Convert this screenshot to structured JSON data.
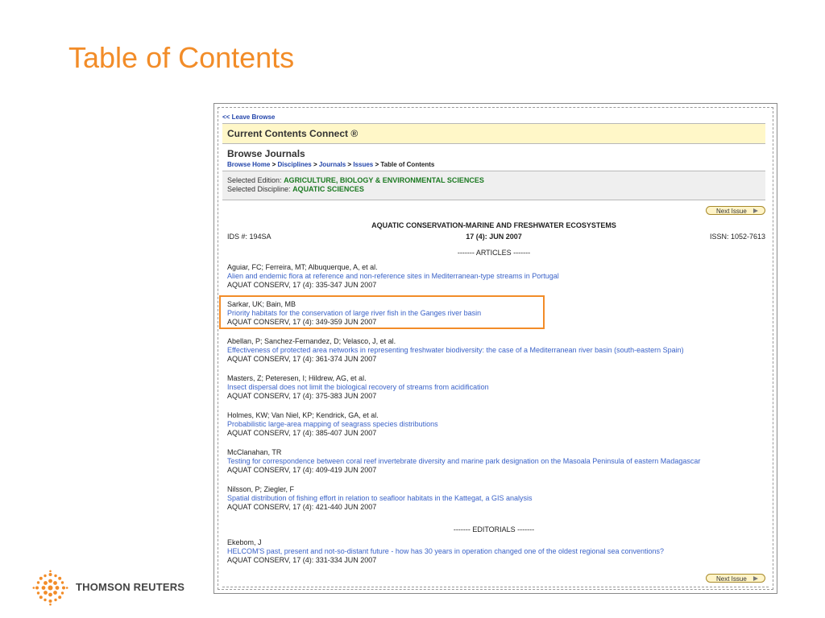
{
  "slide": {
    "title": "Table of Contents"
  },
  "browser": {
    "leave_browse": "<< Leave Browse",
    "product": "Current Contents Connect ®",
    "browse_title": "Browse Journals",
    "breadcrumb": [
      "Browse Home",
      "Disciplines",
      "Journals",
      "Issues",
      "Table of Contents"
    ],
    "edition_label": "Selected Edition:",
    "edition_value": "AGRICULTURE, BIOLOGY & ENVIRONMENTAL SCIENCES",
    "discipline_label": "Selected Discipline:",
    "discipline_value": "AQUATIC SCIENCES",
    "next_issue": "Next Issue",
    "journal_title": "AQUATIC CONSERVATION-MARINE AND FRESHWATER ECOSYSTEMS",
    "ids": "IDS #: 194SA",
    "issue": "17 (4): JUN 2007",
    "issn": "ISSN: 1052-7613",
    "articles_header": "------- ARTICLES -------",
    "editorials_header": "------- EDITORIALS -------",
    "articles": [
      {
        "authors": "Aguiar, FC; Ferreira, MT; Albuquerque, A, et al.",
        "title": "Alien and endemic flora at reference and non-reference sites in Mediterranean-type streams in Portugal",
        "source": "AQUAT CONSERV, 17 (4): 335-347 JUN 2007"
      },
      {
        "authors": "Sarkar, UK; Bain, MB",
        "title": "Priority habitats for the conservation of large river fish in the Ganges river basin",
        "source": "AQUAT CONSERV, 17 (4): 349-359 JUN 2007"
      },
      {
        "authors": "Abellan, P; Sanchez-Fernandez, D; Velasco, J, et al.",
        "title": "Effectiveness of protected area networks in representing freshwater biodiversity: the case of a Mediterranean river basin (south-eastern Spain)",
        "source": "AQUAT CONSERV, 17 (4): 361-374 JUN 2007"
      },
      {
        "authors": "Masters, Z; Peteresen, I; Hildrew, AG, et al.",
        "title": "Insect dispersal does not limit the biological recovery of streams from acidification",
        "source": "AQUAT CONSERV, 17 (4): 375-383 JUN 2007"
      },
      {
        "authors": "Holmes, KW; Van Niel, KP; Kendrick, GA, et al.",
        "title": "Probabilistic large-area mapping of seagrass species distributions",
        "source": "AQUAT CONSERV, 17 (4): 385-407 JUN 2007"
      },
      {
        "authors": "McClanahan, TR",
        "title": "Testing for correspondence between coral reef invertebrate diversity and marine park designation on the Masoala Peninsula of eastern Madagascar",
        "source": "AQUAT CONSERV, 17 (4): 409-419 JUN 2007"
      },
      {
        "authors": "Nilsson, P; Ziegler, F",
        "title": "Spatial distribution of fishing effort in relation to seafloor habitats in the Kattegat, a GIS analysis",
        "source": "AQUAT CONSERV, 17 (4): 421-440 JUN 2007"
      }
    ],
    "editorials": [
      {
        "authors": "Ekebom, J",
        "title": "HELCOM'S past, present and not-so-distant future - how has 30 years in operation changed one of the oldest regional sea conventions?",
        "source": "AQUAT CONSERV, 17 (4): 331-334 JUN 2007"
      }
    ]
  },
  "footer": {
    "logo_text": "THOMSON REUTERS"
  },
  "colors": {
    "accent": "#f28c28",
    "link": "#3a62c8",
    "edition": "#1c7a22"
  }
}
